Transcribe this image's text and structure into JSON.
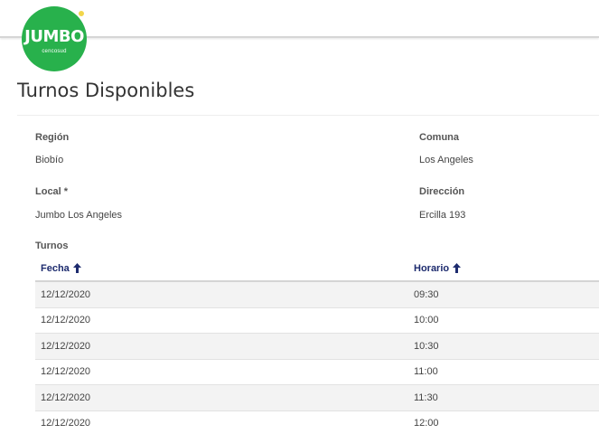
{
  "logo": {
    "word": "JUMBO",
    "sub": "cencosud",
    "color": "#28b14c"
  },
  "page_title": "Turnos Disponibles",
  "fields": {
    "region": {
      "label": "Región",
      "value": "Biobío"
    },
    "comuna": {
      "label": "Comuna",
      "value": "Los Angeles"
    },
    "local": {
      "label": "Local *",
      "value": "Jumbo Los Angeles"
    },
    "direccion": {
      "label": "Dirección",
      "value": "Ercilla 193"
    }
  },
  "turnos": {
    "label": "Turnos",
    "columns": [
      {
        "label": "Fecha",
        "sort": "arrow-up-icon"
      },
      {
        "label": "Horario",
        "sort": "arrow-up-icon"
      }
    ],
    "rows": [
      {
        "fecha": "12/12/2020",
        "horario": "09:30"
      },
      {
        "fecha": "12/12/2020",
        "horario": "10:00"
      },
      {
        "fecha": "12/12/2020",
        "horario": "10:30"
      },
      {
        "fecha": "12/12/2020",
        "horario": "11:00"
      },
      {
        "fecha": "12/12/2020",
        "horario": "11:30"
      },
      {
        "fecha": "12/12/2020",
        "horario": "12:00"
      }
    ]
  },
  "colors": {
    "header_text": "#1d2b6e",
    "row_stripe": "#f3f3f3"
  }
}
